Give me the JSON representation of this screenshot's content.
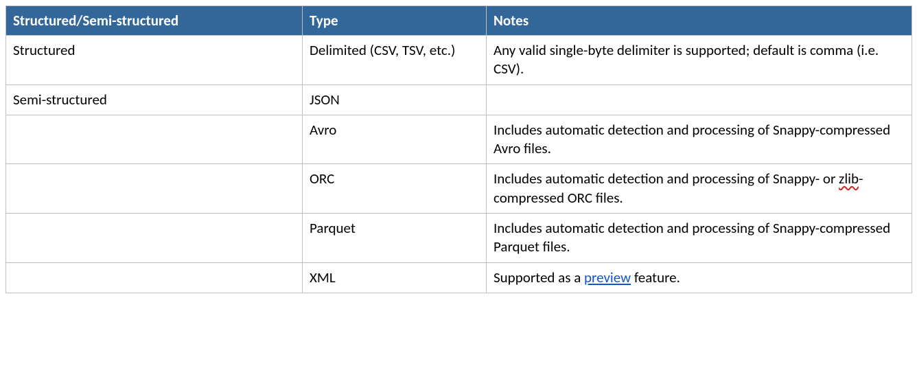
{
  "table": {
    "headers": {
      "col1": "Structured/Semi-structured",
      "col2": "Type",
      "col3": "Notes"
    },
    "rows": {
      "r0": {
        "c0": "Structured",
        "c1": "Delimited (CSV, TSV, etc.)",
        "c2": "Any valid single-byte delimiter is supported; default is comma (i.e. CSV)."
      },
      "r1": {
        "c0": "Semi-structured",
        "c1": "JSON",
        "c2": ""
      },
      "r2": {
        "c0": "",
        "c1": "Avro",
        "c2": "Includes automatic detection and processing of Snappy-compressed Avro files."
      },
      "r3": {
        "c0": "",
        "c1": "ORC",
        "c2_pre": "Includes automatic detection and processing of Snappy- or ",
        "c2_spell": "zlib",
        "c2_post": "-compressed ORC files."
      },
      "r4": {
        "c0": "",
        "c1": "Parquet",
        "c2": "Includes automatic detection and processing of Snappy-compressed Parquet files."
      },
      "r5": {
        "c0": "",
        "c1": "XML",
        "c2_pre": "Supported as a ",
        "c2_link": "preview",
        "c2_post": " feature."
      }
    }
  }
}
